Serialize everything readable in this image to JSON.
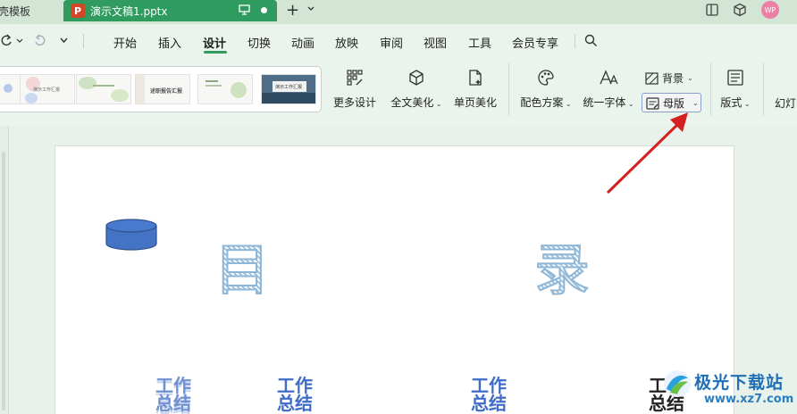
{
  "titlebar": {
    "prev_tab": "壳模板",
    "active_tab": "演示文稿1.pptx",
    "badge": "P",
    "avatar": "WP"
  },
  "menu": {
    "items": [
      "开始",
      "插入",
      "设计",
      "切换",
      "动画",
      "放映",
      "审阅",
      "视图",
      "工具",
      "会员专享"
    ],
    "active": "设计"
  },
  "ribbon": {
    "more_design": "更多设计",
    "full_beautify": "全文美化",
    "page_beautify": "单页美化",
    "color_scheme": "配色方案",
    "unify_font": "统一字体",
    "background": "背景",
    "master": "母版",
    "layout": "版式",
    "slideshow_cut": "幻灯",
    "thumbnails": [
      "演示工作汇报",
      "",
      "述职报告汇报",
      "",
      "演示工作汇报"
    ]
  },
  "slide": {
    "char1": "目",
    "char2": "录",
    "wz": [
      "工作\n总结",
      "工作\n总结",
      "工作\n总结",
      "工作\n总结"
    ]
  },
  "watermark": {
    "title": "极光下载站",
    "url": "www.xz7.com"
  },
  "colors": {
    "accent": "#2f9b5e",
    "annotation_arrow": "#d42020",
    "shape_fill": "#4472c4"
  }
}
